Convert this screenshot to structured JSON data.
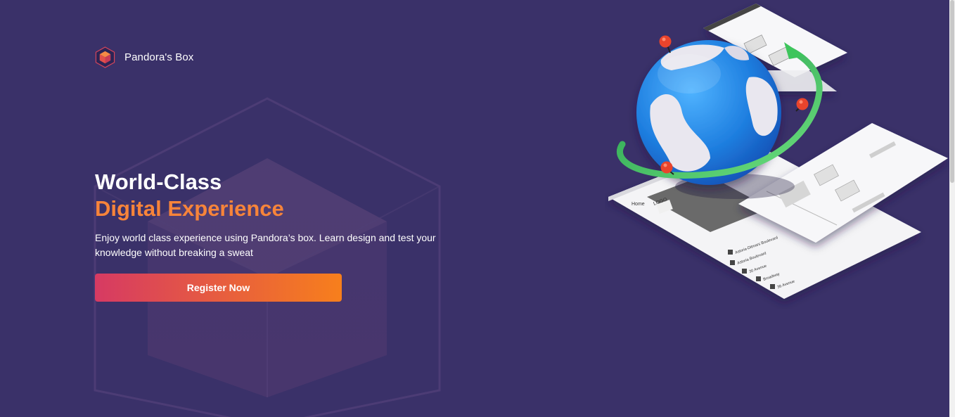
{
  "brand": {
    "name": "Pandora's Box",
    "logo_icon": "cube-logo-icon",
    "logo_color": "#e4533f"
  },
  "hero": {
    "title_line1": "World-Class",
    "title_line2": "Digital Experience",
    "description": "Enjoy world class experience using Pandora’s box. Learn design and test your knowledge without breaking a sweat",
    "accent_color": "#f7843a"
  },
  "cta": {
    "label": "Register Now",
    "gradient_start": "#d63a63",
    "gradient_end": "#f77f1c"
  },
  "illustration": {
    "icon": "globe-with-wireframe-screens-illustration",
    "screen_texts": {
      "home_tab": "Home",
      "logo_box": "LOGO",
      "list_item_1": "Astoria-Ditmars Boulevard",
      "list_item_2": "Astoria Boulevard",
      "list_item_3": "30 Avenue",
      "list_item_4": "Broadway",
      "list_item_5": "36 Avenue"
    }
  },
  "theme": {
    "background": "#3a3169"
  }
}
